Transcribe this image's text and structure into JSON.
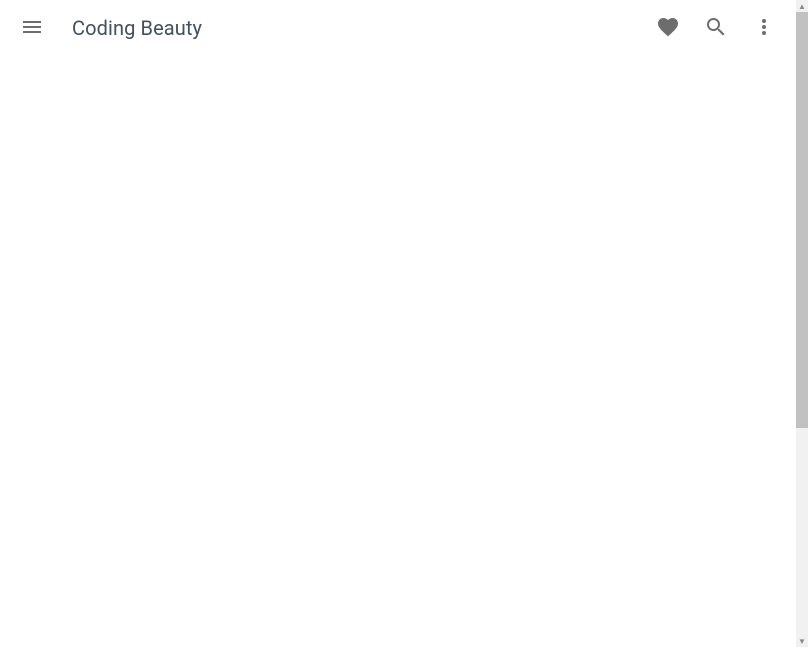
{
  "toolbar": {
    "title": "Coding Beauty",
    "menu_icon": "menu",
    "heart_icon": "heart",
    "search_icon": "search",
    "more_icon": "more-vert"
  }
}
